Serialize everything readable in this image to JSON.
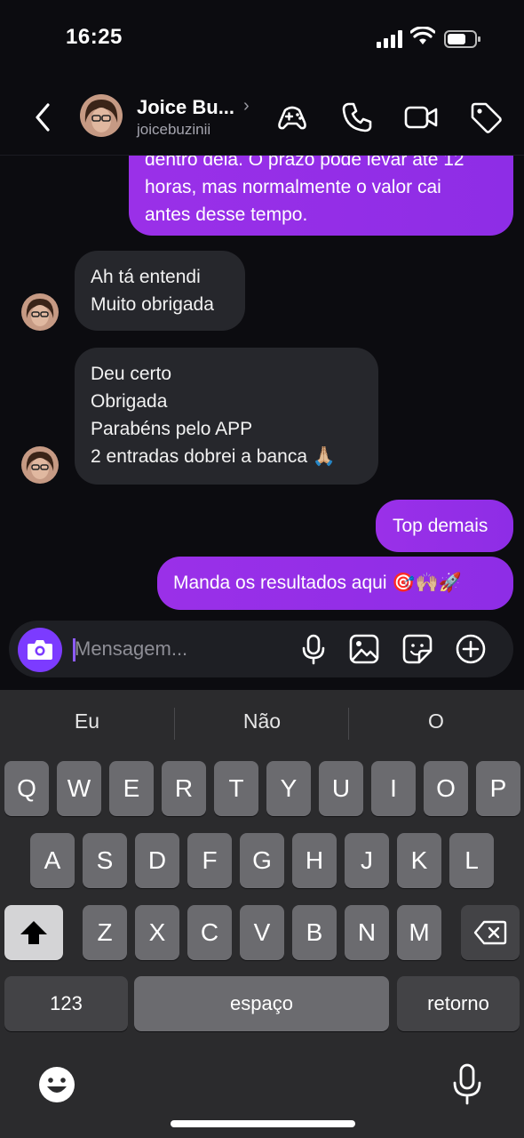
{
  "status_bar": {
    "time": "16:25"
  },
  "header": {
    "name": "Joice Bu...",
    "handle": "joicebuzinii",
    "chevron": "›",
    "icons": [
      "back-chevron-icon",
      "game-icon",
      "phone-icon",
      "video-call-icon",
      "tag-icon"
    ]
  },
  "messages": {
    "m1": {
      "lines": [
        "dentro dela. O prazo pode levar até 12",
        "horas, mas normalmente o valor cai",
        "antes desse tempo."
      ]
    },
    "m2": {
      "lines": [
        "Ah tá entendi",
        "Muito obrigada"
      ]
    },
    "m3": {
      "lines": [
        "Deu certo",
        "Obrigada",
        "Parabéns pelo APP",
        "2 entradas dobrei a banca 🙏🏼"
      ]
    },
    "m4": {
      "text": "Top demais"
    },
    "m5": {
      "text": "Manda os resultados aqui 🎯🙌🏼🚀"
    }
  },
  "composer": {
    "placeholder": "Mensagem..."
  },
  "keyboard": {
    "suggestions": [
      "Eu",
      "Não",
      "O"
    ],
    "row1": [
      "Q",
      "W",
      "E",
      "R",
      "T",
      "Y",
      "U",
      "I",
      "O",
      "P"
    ],
    "row2": [
      "A",
      "S",
      "D",
      "F",
      "G",
      "H",
      "J",
      "K",
      "L"
    ],
    "row3": [
      "Z",
      "X",
      "C",
      "V",
      "B",
      "N",
      "M"
    ],
    "numbers_label": "123",
    "space_label": "espaço",
    "return_label": "retorno"
  },
  "colors": {
    "outgoing": "#9a30e8",
    "incoming": "#26272c",
    "accent": "#7c3bff"
  }
}
